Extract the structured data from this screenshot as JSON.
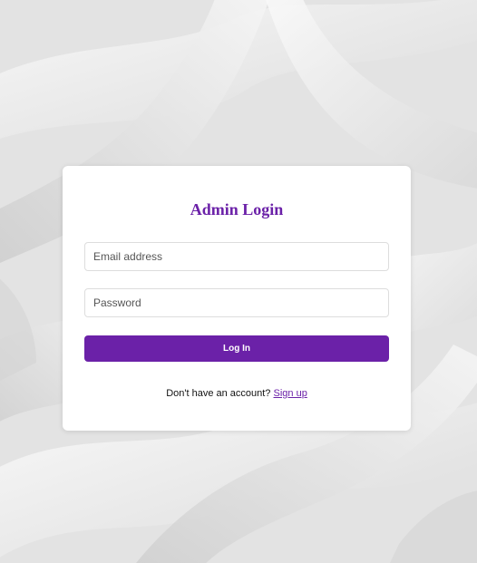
{
  "login": {
    "title": "Admin Login",
    "email_placeholder": "Email address",
    "password_placeholder": "Password",
    "submit_label": "Log In",
    "signup_prompt": "Don't have an account?",
    "signup_link": "Sign up"
  },
  "theme": {
    "accent": "#6b21a8",
    "card_background": "#ffffff",
    "page_background": "#ececec"
  }
}
